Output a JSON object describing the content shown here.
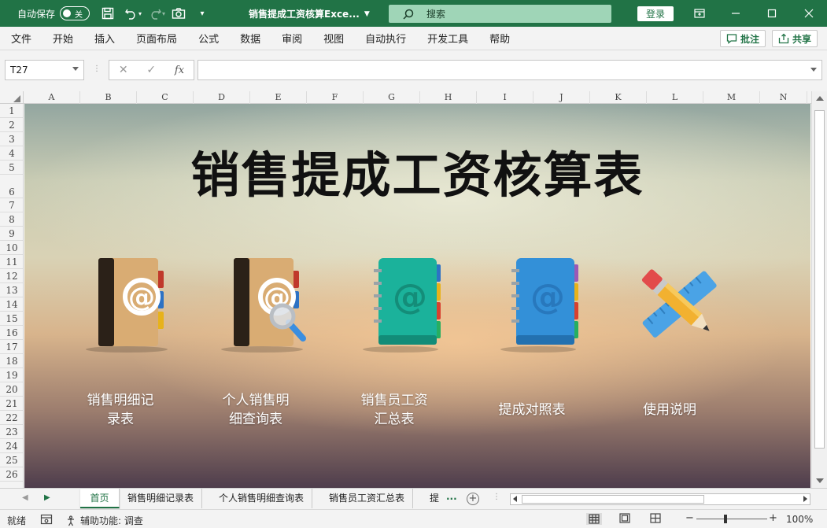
{
  "titlebar": {
    "autosave_label": "自动保存",
    "autosave_state": "关",
    "doc_title": "销售提成工资核算Exce...",
    "search_placeholder": "搜索",
    "login_label": "登录"
  },
  "menu": {
    "items": [
      "文件",
      "开始",
      "插入",
      "页面布局",
      "公式",
      "数据",
      "审阅",
      "视图",
      "自动执行",
      "开发工具",
      "帮助"
    ],
    "comment_label": "批注",
    "share_label": "共享"
  },
  "formula_bar": {
    "name_box": "T27",
    "cancel": "✕",
    "enter": "✓",
    "fx": "fx",
    "value": ""
  },
  "columns": [
    "A",
    "B",
    "C",
    "D",
    "E",
    "F",
    "G",
    "H",
    "I",
    "J",
    "K",
    "L",
    "M",
    "N"
  ],
  "rows": [
    "1",
    "2",
    "3",
    "4",
    "5",
    "6",
    "7",
    "8",
    "9",
    "10",
    "11",
    "12",
    "13",
    "14",
    "15",
    "16",
    "17",
    "18",
    "19",
    "20",
    "21",
    "22",
    "23",
    "24",
    "25",
    "26"
  ],
  "sheet": {
    "title": "销售提成工资核算表",
    "tiles": [
      {
        "line1": "销售明细记",
        "line2": "录表",
        "icon": "address-book-icon"
      },
      {
        "line1": "个人销售明",
        "line2": "细查询表",
        "icon": "address-book-search-icon"
      },
      {
        "line1": "销售员工资",
        "line2": "汇总表",
        "icon": "green-notebook-icon"
      },
      {
        "line1": "提成对照表",
        "line2": "",
        "icon": "blue-notebook-icon"
      },
      {
        "line1": "使用说明",
        "line2": "",
        "icon": "pencil-ruler-icon"
      }
    ]
  },
  "tabs": {
    "items": [
      "首页",
      "销售明细记录表",
      "个人销售明细查询表",
      "销售员工资汇总表",
      "提"
    ],
    "more": "...",
    "active": "首页"
  },
  "status": {
    "ready": "就绪",
    "accessibility": "辅助功能: 调查",
    "zoom_minus": "−",
    "zoom_plus": "+",
    "zoom": "100%"
  },
  "colors": {
    "excel_green": "#217346",
    "search_bg": "#9fd5b7"
  }
}
